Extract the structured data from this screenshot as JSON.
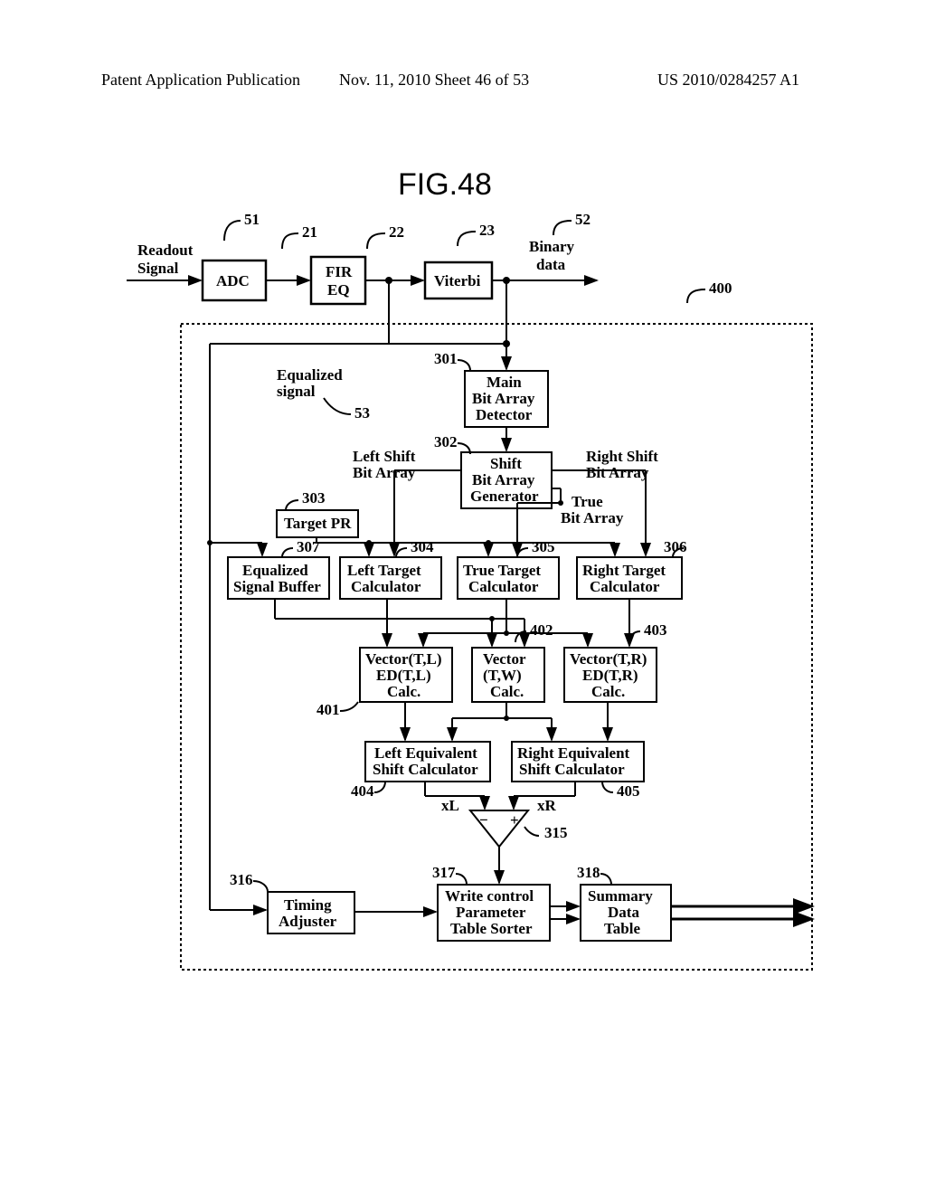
{
  "header": {
    "left": "Patent Application Publication",
    "center": "Nov. 11, 2010  Sheet 46 of 53",
    "right": "US 2010/0284257 A1"
  },
  "figure_title": "FIG.48",
  "labels": {
    "readout_signal_l1": "Readout",
    "readout_signal_l2": "Signal",
    "binary_l1": "Binary",
    "binary_l2": "data",
    "equalized_signal_l1": "Equalized",
    "equalized_signal_l2": "signal",
    "left_shift_l1": "Left Shift",
    "left_shift_l2": "Bit Array",
    "right_shift_l1": "Right Shift",
    "right_shift_l2": "Bit Array",
    "true_bit_l1": "True",
    "true_bit_l2": "Bit Array",
    "xL": "xL",
    "xR": "xR"
  },
  "refs": {
    "r51": "51",
    "r21": "21",
    "r22": "22",
    "r23": "23",
    "r52": "52",
    "r400": "400",
    "r53": "53",
    "r301": "301",
    "r302": "302",
    "r303": "303",
    "r304": "304",
    "r305": "305",
    "r306": "306",
    "r307": "307",
    "r401": "401",
    "r402": "402",
    "r403": "403",
    "r404": "404",
    "r405": "405",
    "r315": "315",
    "r316": "316",
    "r317": "317",
    "r318": "318"
  },
  "blocks": {
    "adc": "ADC",
    "fir_l1": "FIR",
    "fir_l2": "EQ",
    "viterbi": "Viterbi",
    "main_bit_l1": "Main",
    "main_bit_l2": "Bit Array",
    "main_bit_l3": "Detector",
    "shift_gen_l1": "Shift",
    "shift_gen_l2": "Bit Array",
    "shift_gen_l3": "Generator",
    "target_pr": "Target PR",
    "eq_buf_l1": "Equalized",
    "eq_buf_l2": "Signal Buffer",
    "left_tgt_l1": "Left Target",
    "left_tgt_l2": "Calculator",
    "true_tgt_l1": "True Target",
    "true_tgt_l2": "Calculator",
    "right_tgt_l1": "Right Target",
    "right_tgt_l2": "Calculator",
    "vec_tl_l1": "Vector(T,L)",
    "vec_tl_l2": "ED(T,L)",
    "vec_tl_l3": "Calc.",
    "vec_tw_l1": "Vector",
    "vec_tw_l2": "(T,W)",
    "vec_tw_l3": "Calc.",
    "vec_tr_l1": "Vector(T,R)",
    "vec_tr_l2": "ED(T,R)",
    "vec_tr_l3": "Calc.",
    "left_eq_l1": "Left Equivalent",
    "left_eq_l2": "Shift Calculator",
    "right_eq_l1": "Right Equivalent",
    "right_eq_l2": "Shift Calculator",
    "timing_l1": "Timing",
    "timing_l2": "Adjuster",
    "wcp_l1": "Write control",
    "wcp_l2": "Parameter",
    "wcp_l3": "Table Sorter",
    "summary_l1": "Summary",
    "summary_l2": "Data",
    "summary_l3": "Table",
    "minus": "−",
    "plus": "+"
  }
}
